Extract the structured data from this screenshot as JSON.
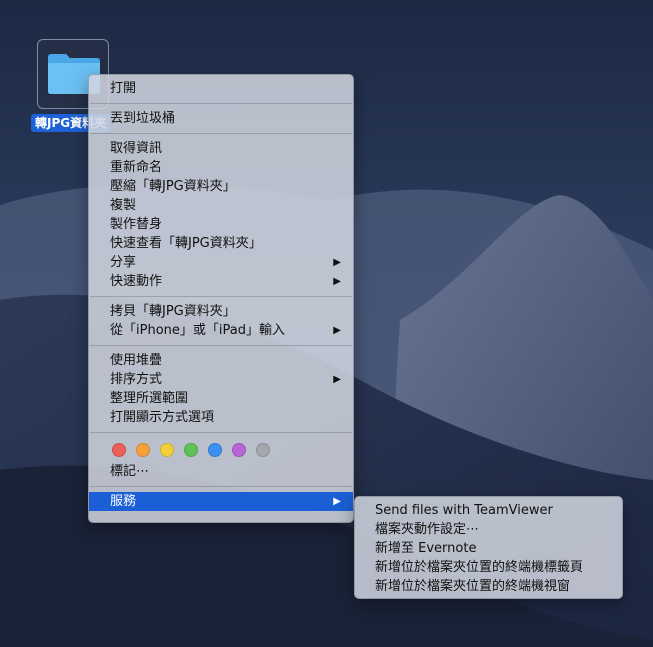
{
  "desktop": {
    "folder_label": "轉JPG資料夾"
  },
  "context_menu": {
    "groups": [
      {
        "items": [
          {
            "label": "打開"
          }
        ]
      },
      {
        "items": [
          {
            "label": "丟到垃圾桶"
          }
        ]
      },
      {
        "items": [
          {
            "label": "取得資訊"
          },
          {
            "label": "重新命名"
          },
          {
            "label": "壓縮「轉JPG資料夾」"
          },
          {
            "label": "複製"
          },
          {
            "label": "製作替身"
          },
          {
            "label": "快速查看「轉JPG資料夾」"
          },
          {
            "label": "分享",
            "submenu": true
          },
          {
            "label": "快速動作",
            "submenu": true
          }
        ]
      },
      {
        "items": [
          {
            "label": "拷貝「轉JPG資料夾」"
          },
          {
            "label": "從「iPhone」或「iPad」輸入",
            "submenu": true
          }
        ]
      },
      {
        "items": [
          {
            "label": "使用堆疊"
          },
          {
            "label": "排序方式",
            "submenu": true
          },
          {
            "label": "整理所選範圍"
          },
          {
            "label": "打開顯示方式選項"
          }
        ]
      }
    ],
    "tag_colors": [
      {
        "name": "red",
        "color": "#ee5f5b"
      },
      {
        "name": "orange",
        "color": "#f5a03b"
      },
      {
        "name": "yellow",
        "color": "#f3cf3a"
      },
      {
        "name": "green",
        "color": "#5fc257"
      },
      {
        "name": "blue",
        "color": "#3a8ff0"
      },
      {
        "name": "purple",
        "color": "#b866d6"
      },
      {
        "name": "gray",
        "color": "#a5a7ad"
      }
    ],
    "tags_label": "標記⋯",
    "services_label": "服務"
  },
  "services_submenu": {
    "items": [
      "Send files with TeamViewer",
      "檔案夾動作設定⋯",
      "新增至 Evernote",
      "新增位於檔案夾位置的終端機標籤頁",
      "新增位於檔案夾位置的終端機視窗"
    ]
  },
  "colors": {
    "highlight": "#1b5fd6",
    "selection_label": "#1d62d7"
  }
}
